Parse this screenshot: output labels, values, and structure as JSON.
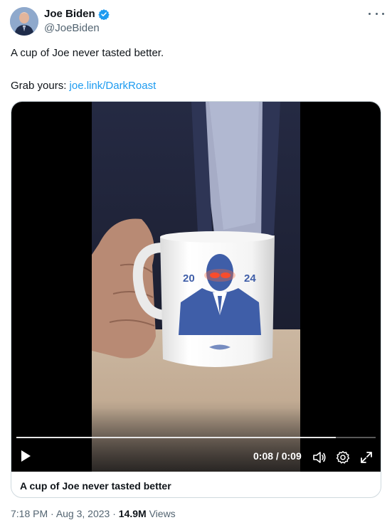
{
  "author": {
    "display_name": "Joe Biden",
    "handle": "@JoeBiden",
    "verified": true,
    "verified_color": "#1d9bf0"
  },
  "tweet": {
    "line1": "A cup of Joe never tasted better.",
    "line2_prefix": "Grab yours: ",
    "link_text": "joe.link/DarkRoast",
    "link_color": "#1d9bf0"
  },
  "video": {
    "current_time": "0:08",
    "separator": " / ",
    "duration": "0:09",
    "progress": 0.89,
    "mug_year_left": "20",
    "mug_year_right": "24",
    "caption": "A cup of Joe never tasted better"
  },
  "meta": {
    "time": "7:18 PM",
    "date": "Aug 3, 2023",
    "dot": " · ",
    "views_count": "14.9M",
    "views_label": " Views"
  },
  "icons": {
    "verified": "verified-badge-icon",
    "more": "more-options-icon",
    "play": "play-icon",
    "volume": "volume-icon",
    "settings": "gear-icon",
    "fullscreen": "expand-icon"
  }
}
